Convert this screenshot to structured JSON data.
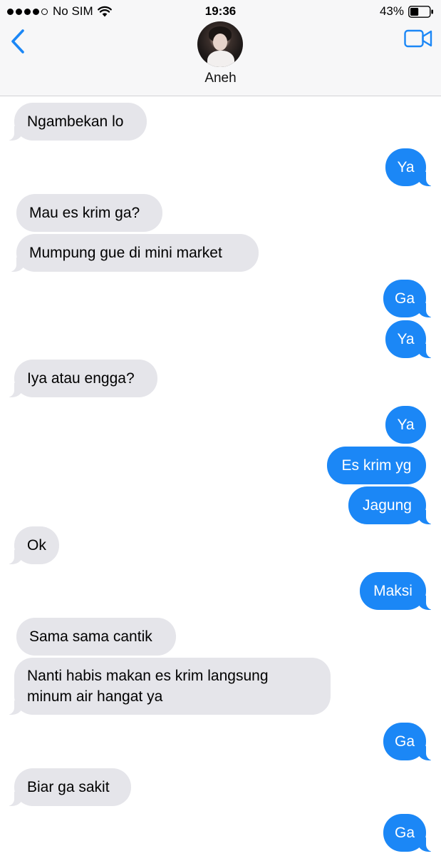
{
  "status_bar": {
    "carrier": "No SIM",
    "time": "19:36",
    "battery": "43%",
    "signal_dots_filled": 4,
    "signal_dots_total": 5,
    "battery_level": 0.43
  },
  "header": {
    "contact_name": "Aneh",
    "accent_color": "#1b87f6"
  },
  "messages": [
    {
      "from": "them",
      "text": "Ngambekan lo"
    },
    {
      "from": "me",
      "text": "Ya"
    },
    {
      "from": "them",
      "text": "Mau es krim ga?"
    },
    {
      "from": "them",
      "text": "Mumpung gue di mini market"
    },
    {
      "from": "me",
      "text": "Ga"
    },
    {
      "from": "me",
      "text": "Ya"
    },
    {
      "from": "them",
      "text": "Iya atau engga?"
    },
    {
      "from": "me",
      "text": "Ya"
    },
    {
      "from": "me",
      "text": "Es krim yg"
    },
    {
      "from": "me",
      "text": "Jagung"
    },
    {
      "from": "them",
      "text": "Ok"
    },
    {
      "from": "me",
      "text": "Maksi"
    },
    {
      "from": "them",
      "text": "Sama sama cantik"
    },
    {
      "from": "them",
      "text": "Nanti habis makan es krim langsung\nminum air hangat ya"
    },
    {
      "from": "me",
      "text": "Ga"
    },
    {
      "from": "them",
      "text": "Biar ga sakit"
    },
    {
      "from": "me",
      "text": "Ga"
    }
  ],
  "colors": {
    "incoming_bubble": "#e5e5ea",
    "outgoing_bubble": "#1b87f6",
    "header_background": "#f7f7f8"
  },
  "icons": {
    "back": "chevron-left-icon",
    "video": "video-camera-icon",
    "wifi": "wifi-icon",
    "battery": "battery-icon"
  }
}
